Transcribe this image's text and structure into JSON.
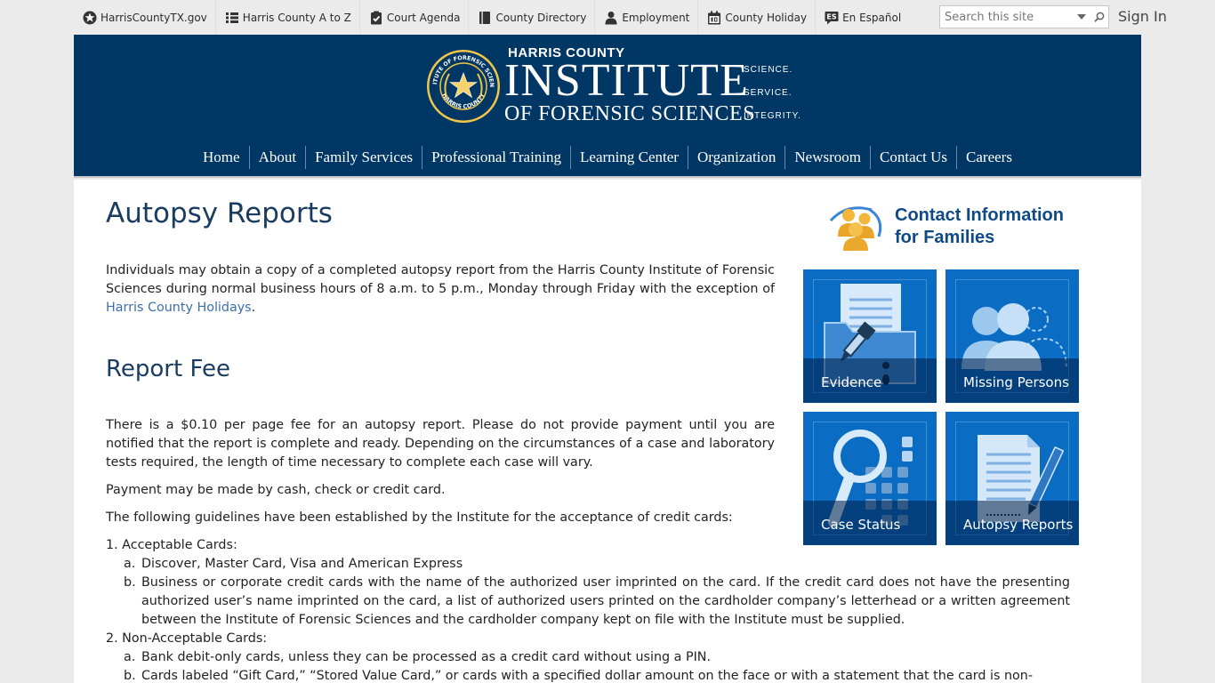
{
  "topbar": {
    "links": [
      {
        "label": "HarrisCountyTX.gov",
        "icon": "star-badge-icon"
      },
      {
        "label": "Harris County A to Z",
        "icon": "list-icon"
      },
      {
        "label": "Court Agenda",
        "icon": "clipboard-icon"
      },
      {
        "label": "County Directory",
        "icon": "book-icon"
      },
      {
        "label": "Employment",
        "icon": "person-icon"
      },
      {
        "label": "County Holiday",
        "icon": "calendar-icon"
      },
      {
        "label": "En Español",
        "icon": "es-icon"
      }
    ],
    "search_placeholder": "Search this site",
    "signin_label": "Sign In"
  },
  "header": {
    "brand_top": "HARRIS COUNTY",
    "brand_main": "INSTITUTE",
    "brand_sub": "OF FORENSIC SCIENCES",
    "tagline": [
      "SCIENCE.",
      "SERVICE.",
      "INTEGRITY."
    ],
    "seal_ring_text": "INSTITUTE OF FORENSIC SCIENCES",
    "seal_bottom_text": "HARRIS COUNTY"
  },
  "nav": [
    "Home",
    "About",
    "Family Services",
    "Professional Training",
    "Learning Center",
    "Organization",
    "Newsroom",
    "Contact Us",
    "Careers"
  ],
  "main": {
    "title": "Autopsy Reports",
    "intro_text": "Individuals may obtain a copy of a completed autopsy report from the Harris County Institute of Forensic Sciences during normal business hours of 8 a.m. to 5 p.m., Monday through Friday with the exception of ",
    "intro_link": "Harris County Holidays",
    "intro_end": ".",
    "fee_heading": "Report Fee",
    "fee_text": "There is a $0.10 per page fee for an autopsy report. Please do not provide payment until you are notified that the report is complete and ready. Depending on the circumstances of a case and laboratory tests required, the length of time necessary to complete each case will vary.",
    "payment_text": "Payment may be made by cash, check or credit card.",
    "guidelines_text": "The following guidelines have been established by the Institute for the acceptance of credit cards:",
    "list": {
      "item1": "1. Acceptable Cards:",
      "item1a_marker": "a.",
      "item1a": "Discover, Master Card, Visa and American Express",
      "item1b_marker": "b.",
      "item1b": "Business or corporate credit cards with the name of the authorized user imprinted on the card. If the credit card does not have the presenting authorized user’s name imprinted on the card, a list of authorized users printed on the cardholder company’s letterhead or a written agreement between the Institute of Forensic Sciences and the cardholder company kept on file with the Institute must be supplied.",
      "item2": "2. Non-Acceptable Cards:",
      "item2a_marker": "a.",
      "item2a": "Bank debit-only cards, unless they can be processed as a credit card without using a PIN.",
      "item2b_marker": "b.",
      "item2b": "Cards labeled “Gift Card,” “Stored Value Card,” or cards with a specified dollar amount on the face or with a statement that the card is non-"
    }
  },
  "sidebar": {
    "contact_title_line1": "Contact Information",
    "contact_title_line2": "for Families",
    "tiles": [
      "Evidence",
      "Missing Persons",
      "Case Status",
      "Autopsy Reports"
    ]
  },
  "colors": {
    "header_bg": "#003764",
    "tile_bg": "#0a6cc2",
    "heading": "#1a3c60",
    "link": "#3b6fb0",
    "contact_title": "#0e4b86"
  }
}
